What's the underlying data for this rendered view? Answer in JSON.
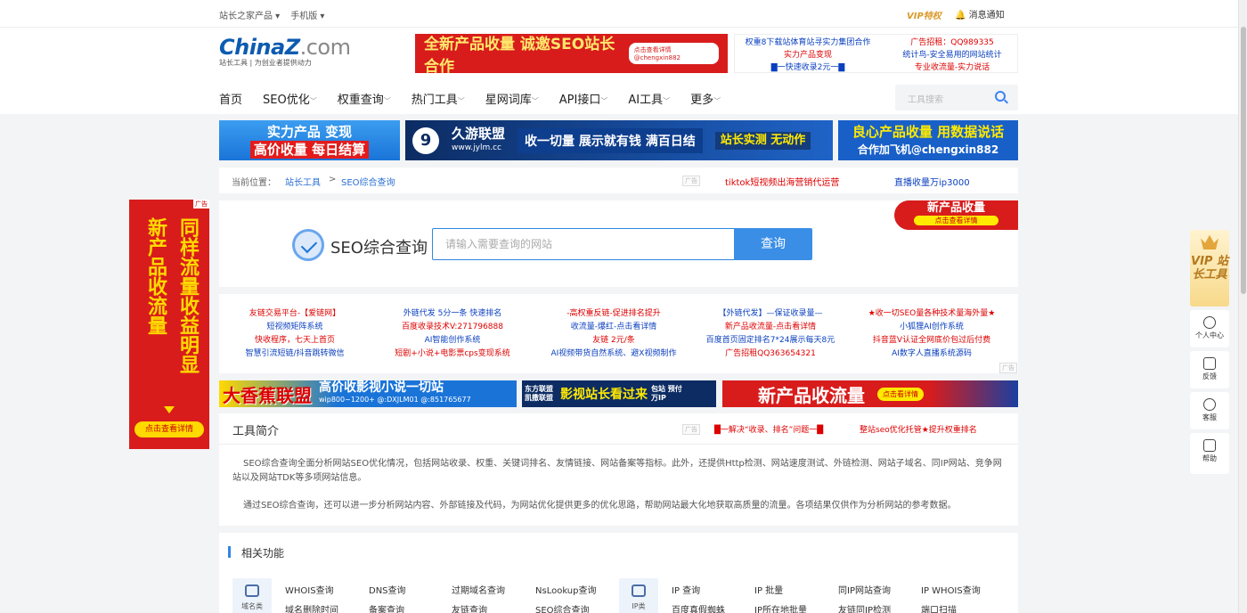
{
  "topbar": {
    "links": [
      "站长之家产品 ▾",
      "手机版 ▾"
    ],
    "vip": "VIP特权",
    "notice": "消息通知"
  },
  "logo": {
    "brand": "ChinaZ",
    "suffix": ".com",
    "sub": "站长工具 | 为创业者提供动力"
  },
  "ad_top": {
    "text": "全新产品收量 诚邀SEO站长合作",
    "pill": "点击查看详情 @chengxin882"
  },
  "text_ads": {
    "c1": [
      "权重8下载站体育站寻实力集团合作",
      "实力产品变现",
      "▇一快速收录2元一▇"
    ],
    "c2": [
      "广告招租：QQ989335",
      "统计鸟-安全易用的网站统计",
      "专业收流量-实力说话"
    ]
  },
  "nav": [
    "首页",
    "SEO优化",
    "权重查询",
    "热门工具",
    "星网词库",
    "API接口",
    "AI工具",
    "更多"
  ],
  "search_top": {
    "placeholder": "工具搜索"
  },
  "banners": {
    "b1_line1": "实力产品 变现",
    "b1_line2": "高价收量 每日结算",
    "b2_logo": "久游联盟",
    "b2_url": "www.jylm.cc",
    "b2_slogan": "收一切量 展示就有钱 满百日结",
    "b2_act": "站长实测 无动作",
    "b3_line1": "良心产品收量 用数据说话",
    "b3_line2": "合作加飞机@chengxin882"
  },
  "crumb": {
    "label": "当前位置：",
    "link1": "站长工具",
    "sep": ">",
    "link2": "SEO综合查询",
    "ad": "广告",
    "t1": "tiktok短视频出海营销代运营",
    "t2": "直播收量万ip3000"
  },
  "main": {
    "title": "SEO综合查询",
    "placeholder": "请输入需要查询的网站",
    "button": "查询",
    "ad_line1": "新产品收量",
    "ad_line2": "点击查看详情"
  },
  "grid_ads": [
    [
      "友链交易平台-【爱链网】",
      "短视频矩阵系统",
      "快收程序，七天上首页",
      "智慧引流短链/抖音跳转微信"
    ],
    [
      "外链代发 5分一条 快速排名",
      "百度收录技术V:271796888",
      "AI智能创作系统",
      "短剧+小说+电影票cps变现系统"
    ],
    [
      "-高权重反链-促进排名提升",
      "收流量-爆红-点击看详情",
      "友链 2元/条",
      "AI视频带货自然系统、避X视频制作"
    ],
    [
      "【外链代发】—保证收录量—",
      "新产品收流量-点击看详情",
      "百度首页固定排名7*24展示每天8元",
      "广告招租QQ363654321"
    ],
    [
      "★收一切SEO量各种技术量海外量★",
      "小狐狸AI创作系统",
      "抖音蓝V认证全网底价包过后付费",
      "AI数字人直播系统源码"
    ]
  ],
  "strips": {
    "s1_big": "大香蕉联盟",
    "s1_slogan": "高价收影视小说一切站",
    "s1_sub": "wip800~1200+ @:DXJLM01 @:851765677",
    "s2_sm": "东方联盟 凯撒联盟",
    "s2_main": "影视站长看过来",
    "s2_tail": "包站 预付 万IP",
    "s3_main": "新产品收流量",
    "s3_pill": "点击看详情"
  },
  "intro": {
    "title": "工具简介",
    "ad1": "█一解决“收录、排名”问题一█",
    "ad2": "整站seo优化托管★提升权重排名",
    "p1": "SEO综合查询全面分析网站SEO优化情况，包括网站收录、权重、关键词排名、友情链接、网站备案等指标。此外，还提供Http检测、网站速度测试、外链检测、网站子域名、同IP网站、竞争网站以及网站TDK等多项网站信息。",
    "p2": "通过SEO综合查询，还可以进一步分析网站内容、外部链接及代码，为网站优化提供更多的优化思路，帮助网站最大化地获取高质量的流量。各项结果仅供作为分析网站的参考数据。"
  },
  "related": {
    "title": "相关功能",
    "cat1": "域名类",
    "cat2": "IP类",
    "domain_links_row1": [
      "WHOIS查询",
      "DNS查询",
      "过期域名查询",
      "NsLookup查询"
    ],
    "domain_links_row2": [
      "域名删除时间",
      "备案查询",
      "友链查询",
      "SEO综合查询"
    ],
    "ip_links_row1": [
      "IP 查询",
      "IP 批量",
      "同IP网站查询",
      "IP WHOIS查询"
    ],
    "ip_links_row2": [
      "百度真假蜘蛛",
      "IP所在地批量",
      "友链同IP检测",
      "端口扫描"
    ]
  },
  "left_ad": {
    "col1": "新产品收流量",
    "col2": "同样流量收益明显",
    "btn": "点击查看详情",
    "tag": "广告"
  },
  "side": {
    "vip": "VIP 站长工具",
    "user": "个人中心",
    "feedback": "反馈",
    "service": "客服",
    "help": "帮助"
  }
}
